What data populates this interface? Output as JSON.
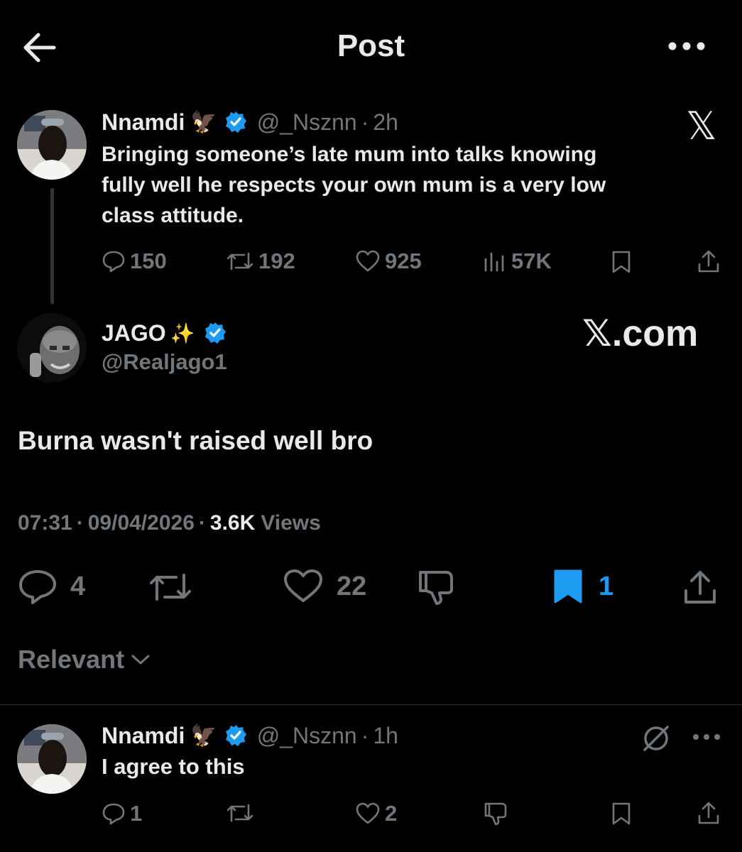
{
  "header": {
    "title": "Post",
    "back_icon": "arrow-left-icon",
    "more_icon": "more-horizontal-icon"
  },
  "quoted": {
    "name": "Nnamdi",
    "emoji": "🦅",
    "handle": "@_Nsznn",
    "time": "2h",
    "text_lines": [
      "Bringing someone’s late mum into talks knowing",
      "fully well he respects your own mum is a very low",
      "class attitude."
    ],
    "replies": "150",
    "reposts": "192",
    "likes": "925",
    "views": "57K",
    "x_logo": "𝕏"
  },
  "main": {
    "name": "JAGO",
    "emoji": "✨",
    "handle": "@Realjago1",
    "watermark": "𝕏.com",
    "text": "Burna wasn't raised well bro",
    "time": "07:31",
    "date": "09/04/2026",
    "views_count": "3.6K",
    "views_label": "Views",
    "replies": "4",
    "likes": "22",
    "bookmarks": "1",
    "accent_color": "#1d9bf0"
  },
  "sort": {
    "label": "Relevant"
  },
  "reply": {
    "name": "Nnamdi",
    "emoji": "🦅",
    "handle": "@_Nsznn",
    "time": "1h",
    "text": "I agree to this",
    "replies": "1",
    "likes": "2"
  }
}
